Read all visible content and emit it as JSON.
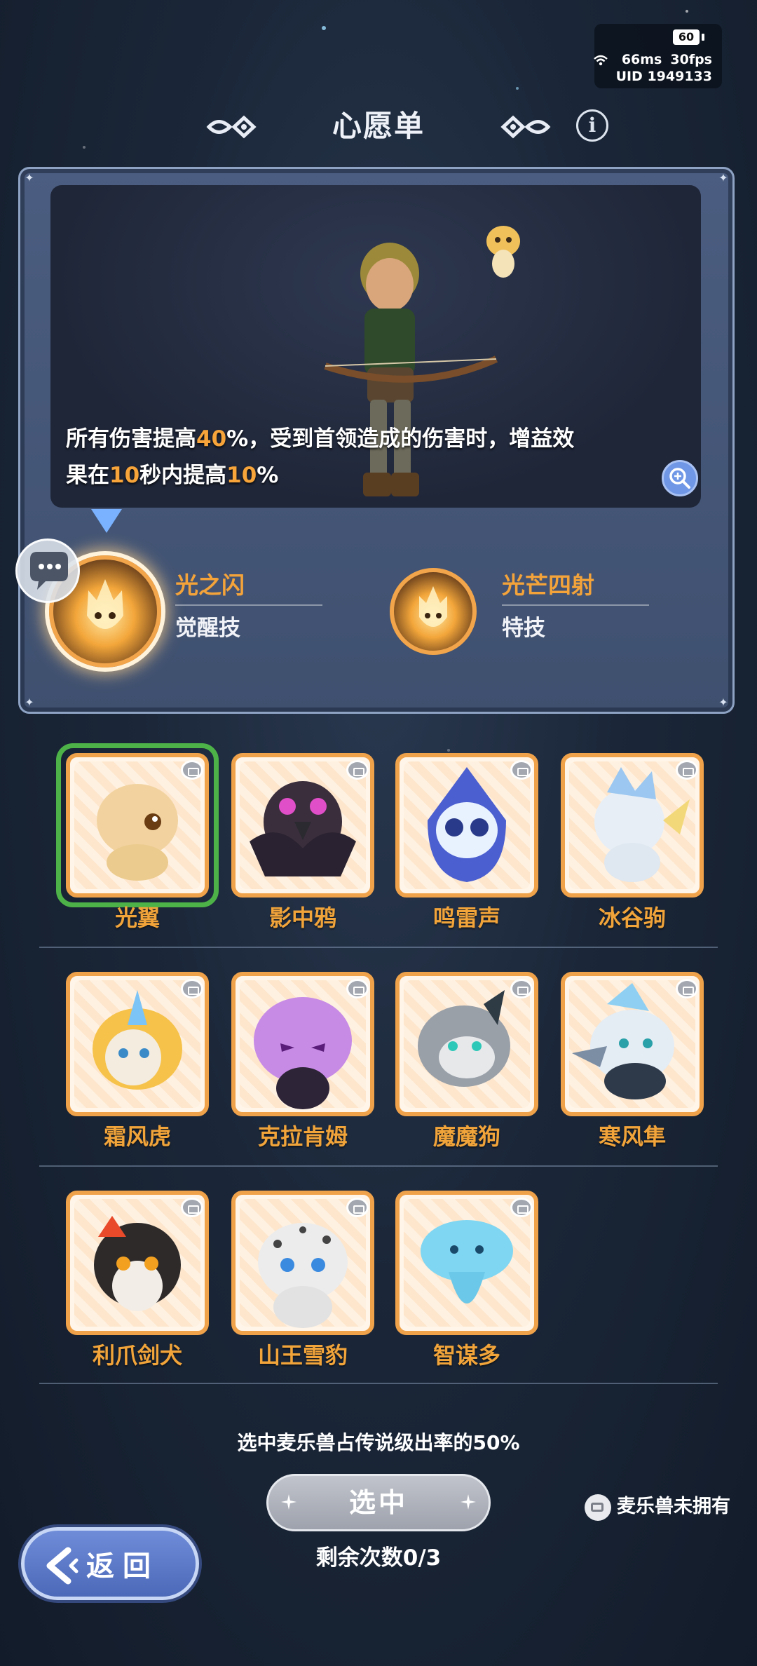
{
  "status": {
    "battery": "60",
    "ping": "66ms",
    "fps": "30fps",
    "uid": "UID 1949133"
  },
  "header": {
    "title": "心愿单"
  },
  "preview": {
    "desc_part1": "所有伤害提高",
    "desc_val1": "40",
    "desc_part2": "%，受到首领造成的伤害时，增益效",
    "desc_part3": "果在",
    "desc_val2": "10",
    "desc_part4": "秒内提高",
    "desc_val3": "10",
    "desc_part5": "%"
  },
  "skills": [
    {
      "name": "光之闪",
      "type": "觉醒技"
    },
    {
      "name": "光芒四射",
      "type": "特技"
    }
  ],
  "pets": [
    {
      "name": "光翼",
      "color": "#f2d3a0"
    },
    {
      "name": "影中鸦",
      "color": "#3a2e3c"
    },
    {
      "name": "鸣雷声",
      "color": "#4b5fd0"
    },
    {
      "name": "冰谷驹",
      "color": "#e7eef6"
    },
    {
      "name": "霜风虎",
      "color": "#f6c24a"
    },
    {
      "name": "克拉肯姆",
      "color": "#c78be6"
    },
    {
      "name": "魔魔狗",
      "color": "#9aa0a8"
    },
    {
      "name": "寒风隼",
      "color": "#e4ecf4"
    },
    {
      "name": "利爪剑犬",
      "color": "#2e2a2a"
    },
    {
      "name": "山王雪豹",
      "color": "#ececec"
    },
    {
      "name": "智谋多",
      "color": "#7fd6f2"
    }
  ],
  "selected_pet": "光翼",
  "footer": {
    "rate_note": "选中麦乐兽占传说级出率的50%",
    "select_label": "选中",
    "remaining": "剩余次数0/3",
    "legend": "麦乐兽未拥有",
    "back_label": "返回"
  },
  "colors": {
    "accent_orange": "#f3a33a",
    "selected_green": "#4db348",
    "back_blue": "#5677c6"
  }
}
